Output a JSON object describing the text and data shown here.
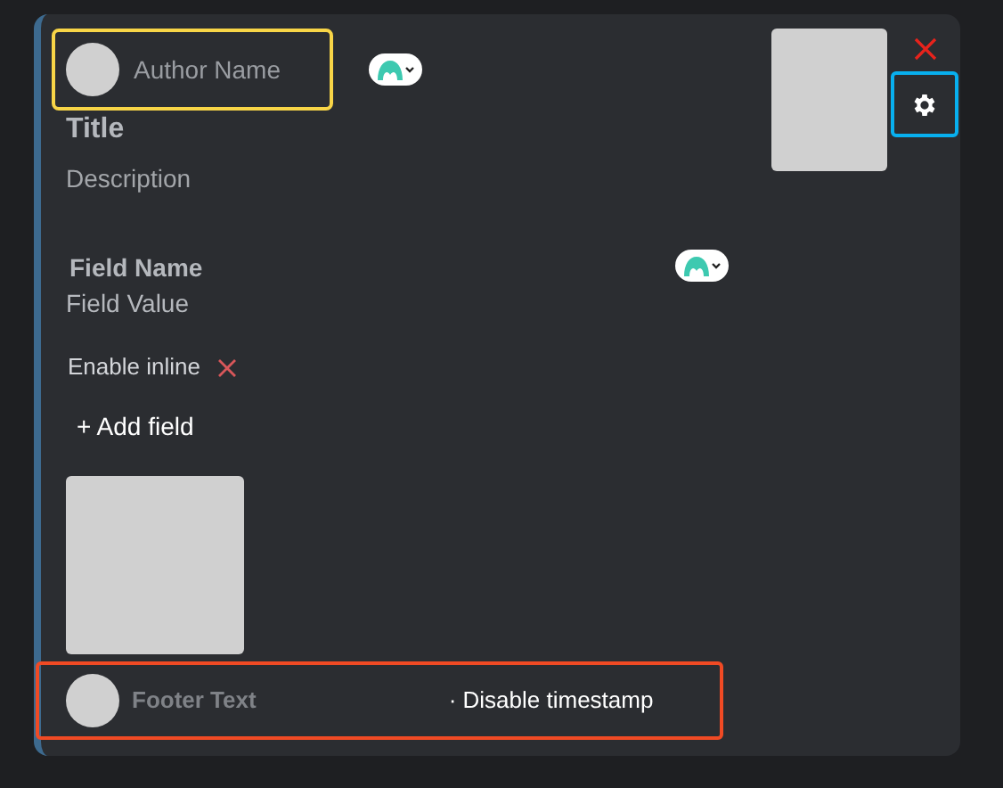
{
  "author": {
    "name": "Author Name",
    "highlighted": true
  },
  "title": "Title",
  "description": "Description",
  "fields": [
    {
      "name": "Field Name",
      "value": "Field Value",
      "inline_label": "Enable inline"
    }
  ],
  "add_field": "+ Add field",
  "footer": {
    "text": "Footer Text",
    "timestamp_toggle": "· Disable timestamp",
    "highlighted": true
  },
  "settings_button": {
    "highlighted": true
  }
}
